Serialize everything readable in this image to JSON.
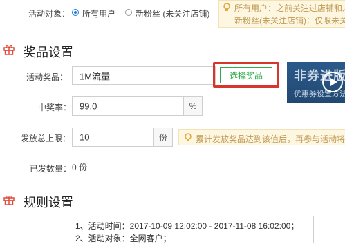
{
  "audience": {
    "label": "活动对象：",
    "options": [
      "所有用户",
      "新粉丝 (未关注店铺)"
    ],
    "selected_index": 0,
    "tip_lines": [
      "所有用户：之前关注过店铺和未",
      "新粉丝(未关注店铺)：仅限未关"
    ]
  },
  "prize_section": {
    "title": "奖品设置",
    "prize": {
      "label": "活动奖品：",
      "value": "1M流量",
      "button": "选择奖品"
    },
    "rate": {
      "label": "中奖率：",
      "value": "99.0",
      "unit": "%"
    },
    "limit": {
      "label": "发放总上限：",
      "value": "10",
      "unit": "份",
      "tip": "累计发放奖品达到该值后，再参与活动将"
    },
    "issued": {
      "label": "已发数量：",
      "value": "0 份"
    }
  },
  "banner": {
    "title": "非券进版",
    "subtitle": "优惠券设置方法"
  },
  "rules_section": {
    "title": "规则设置",
    "lines": [
      "1、活动时间：2017-10-09 12:02:00 - 2017-11-08 16:02:00；",
      "2、活动对象：全网客户；"
    ]
  },
  "colors": {
    "accent_green": "#2dac4c",
    "highlight_red": "#d9362b",
    "radio_blue": "#1a7ad6",
    "gift_red": "#e04a3a"
  }
}
